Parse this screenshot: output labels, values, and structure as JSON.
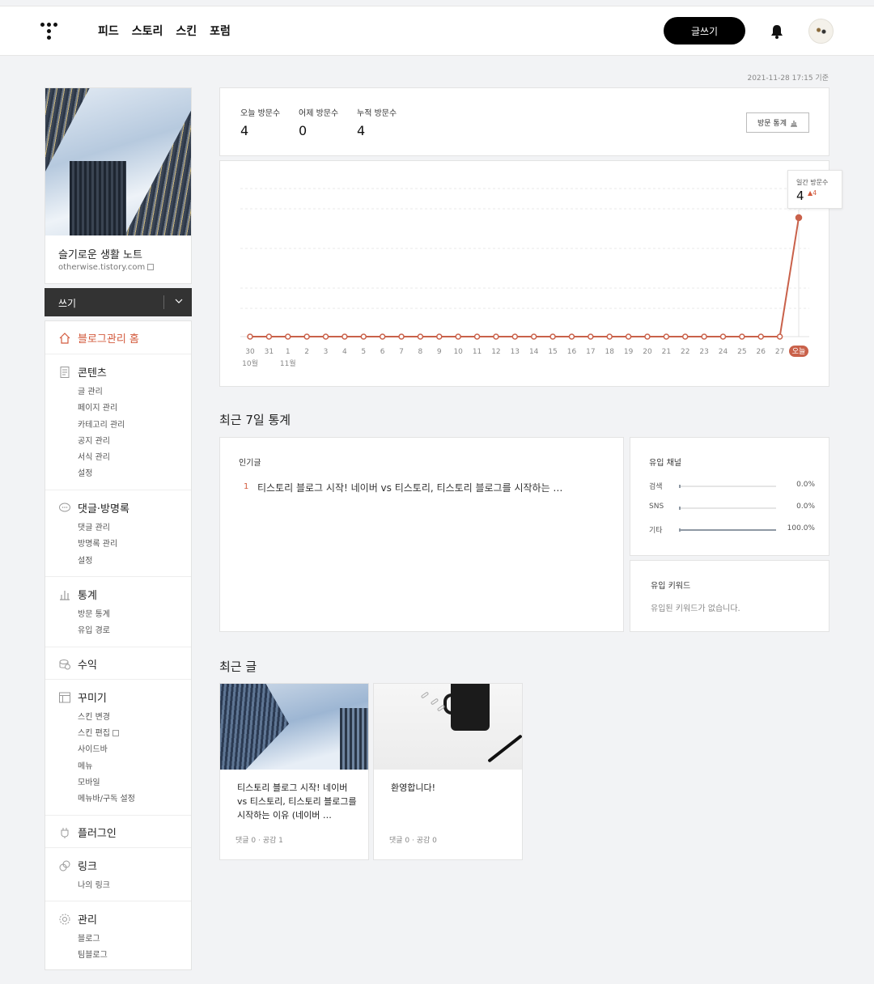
{
  "header": {
    "nav": [
      "피드",
      "스토리",
      "스킨",
      "포럼"
    ],
    "write_button": "글쓰기"
  },
  "profile": {
    "title": "슬기로운 생활 노트",
    "url": "otherwise.tistory.com"
  },
  "write_bar": {
    "label": "쓰기"
  },
  "menu": {
    "home": "블로그관리 홈",
    "contents": {
      "label": "콘텐츠",
      "items": [
        "글 관리",
        "페이지 관리",
        "카테고리 관리",
        "공지 관리",
        "서식 관리",
        "설정"
      ]
    },
    "comments": {
      "label": "댓글·방명록",
      "items": [
        "댓글 관리",
        "방명록 관리",
        "설정"
      ]
    },
    "stats": {
      "label": "통계",
      "items": [
        "방문 통계",
        "유입 경로"
      ]
    },
    "revenue": {
      "label": "수익"
    },
    "design": {
      "label": "꾸미기",
      "items": [
        "스킨 변경",
        "스킨 편집",
        "사이드바",
        "메뉴",
        "모바일",
        "메뉴바/구독 설정"
      ]
    },
    "plugin": {
      "label": "플러그인"
    },
    "link": {
      "label": "링크",
      "items": [
        "나의 링크"
      ]
    },
    "manage": {
      "label": "관리",
      "items": [
        "블로그",
        "팀블로그"
      ]
    }
  },
  "timestamp": "2021-11-28 17:15 기준",
  "visits": {
    "today_label": "오늘 방문수",
    "today": "4",
    "yesterday_label": "어제 방문수",
    "yesterday": "0",
    "total_label": "누적 방문수",
    "total": "4",
    "button": "방문 통계"
  },
  "tooltip": {
    "label": "일간 방문수",
    "value": "4",
    "delta": "4"
  },
  "chart_data": {
    "type": "line",
    "categories": [
      "30",
      "31",
      "1",
      "2",
      "3",
      "4",
      "5",
      "6",
      "7",
      "8",
      "9",
      "10",
      "11",
      "12",
      "13",
      "14",
      "15",
      "16",
      "17",
      "18",
      "19",
      "20",
      "21",
      "22",
      "23",
      "24",
      "25",
      "26",
      "27",
      "오늘"
    ],
    "month_labels": [
      "10월",
      "11월"
    ],
    "series": [
      {
        "values": [
          0,
          0,
          0,
          0,
          0,
          0,
          0,
          0,
          0,
          0,
          0,
          0,
          0,
          0,
          0,
          0,
          0,
          0,
          0,
          0,
          0,
          0,
          0,
          0,
          0,
          0,
          0,
          0,
          0,
          4
        ]
      }
    ],
    "color": "#c9614a",
    "ylim": [
      0,
      4
    ]
  },
  "recent7": {
    "title": "최근 7일 통계",
    "popular_label": "인기글",
    "popular": [
      {
        "rank": "1",
        "title": "티스토리 블로그 시작! 네이버 vs 티스토리, 티스토리 블로그를 시작하는 …"
      }
    ],
    "channels_label": "유입 채널",
    "channels": [
      {
        "name": "검색",
        "percent": "0.0%",
        "fraction": 0.0
      },
      {
        "name": "SNS",
        "percent": "0.0%",
        "fraction": 0.0
      },
      {
        "name": "기타",
        "percent": "100.0%",
        "fraction": 1.0
      }
    ],
    "keywords_label": "유입 키워드",
    "keywords_empty": "유입된 키워드가 없습니다."
  },
  "recent_posts": {
    "title": "최근 글",
    "posts": [
      {
        "title": "티스토리 블로그 시작! 네이버 vs 티스토리, 티스토리 블로그를 시작하는 이유 (네이버 …",
        "meta": "댓글 0 · 공감 1"
      },
      {
        "title": "환영합니다!",
        "meta": "댓글 0 · 공감 0"
      }
    ]
  },
  "colors": {
    "accent": "#d35b3e",
    "line": "#c9614a"
  }
}
